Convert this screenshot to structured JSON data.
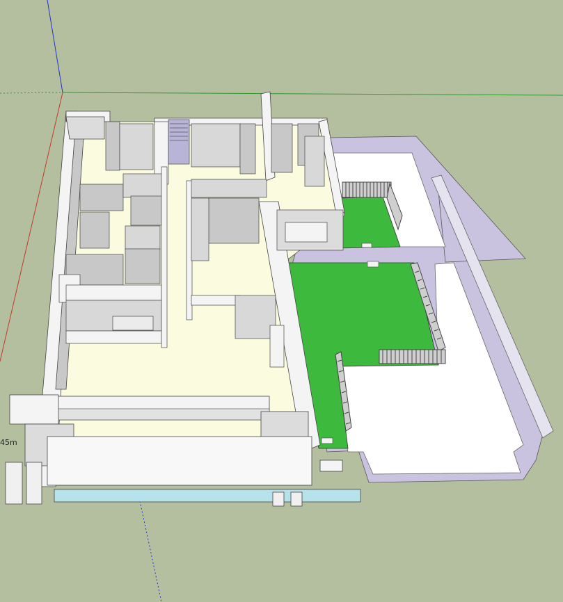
{
  "viewport": {
    "background_color": "#b4bf9f",
    "dimension_label": "45m"
  },
  "axes": {
    "red_axis_color": "#c0392b",
    "green_axis_color": "#2e9c2e",
    "blue_axis_color": "#2233cc"
  },
  "model": {
    "wall_face_color": "#f4f4f4",
    "wall_side_color": "#c8c8c8",
    "floor_color": "#fbfbe0",
    "lawn_color": "#3dba3d",
    "terrace_color": "#ffffff",
    "parapet_color": "#c9c3df",
    "window_color": "#b6e2ec",
    "stair_color": "#b8b4d8"
  }
}
